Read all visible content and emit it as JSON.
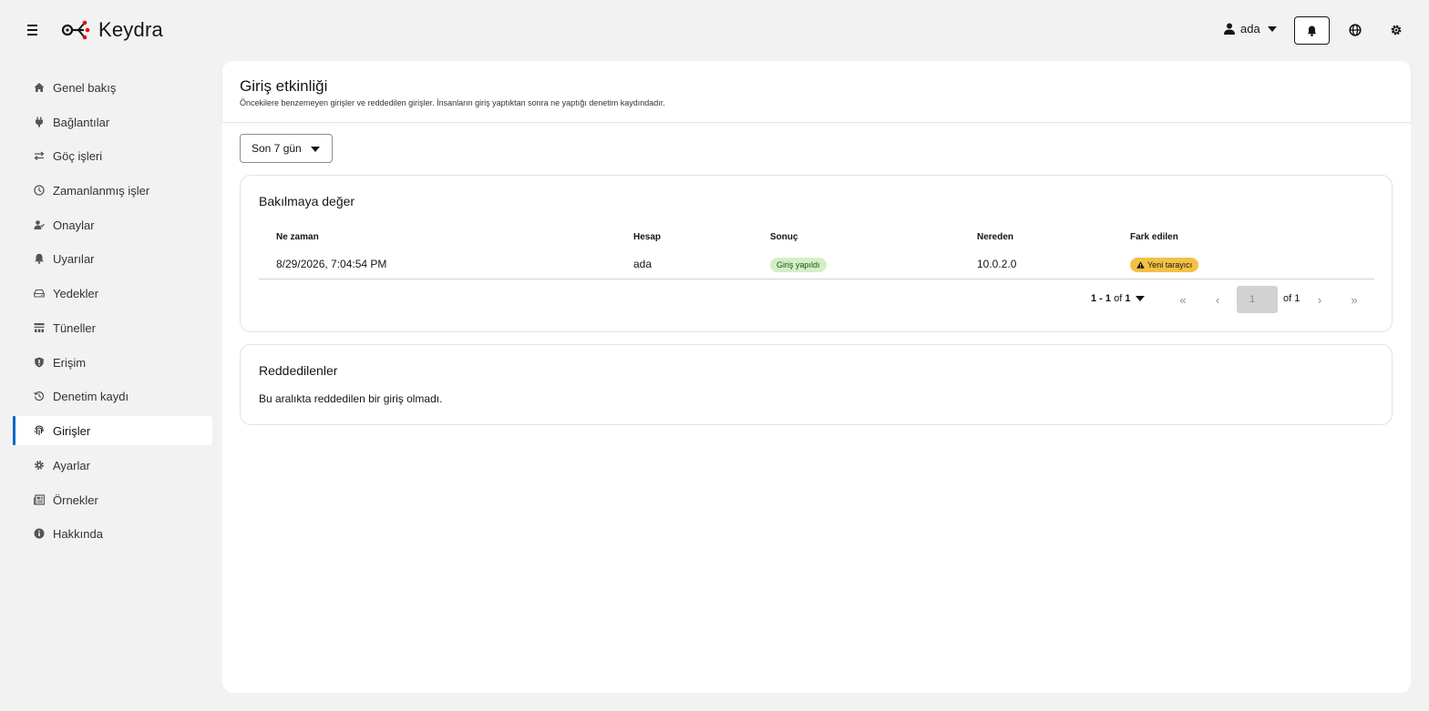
{
  "header": {
    "app_name": "Keydra",
    "user_name": "ada",
    "icons": [
      "hamburger-icon",
      "keydra-logo",
      "user-icon",
      "bell-icon",
      "globe-icon",
      "gear-icon"
    ]
  },
  "sidebar": {
    "items": [
      {
        "label": "Genel bakış",
        "icon": "home-icon"
      },
      {
        "label": "Bağlantılar",
        "icon": "plug-icon"
      },
      {
        "label": "Göç işleri",
        "icon": "exchange-icon"
      },
      {
        "label": "Zamanlanmış işler",
        "icon": "clock-icon"
      },
      {
        "label": "Onaylar",
        "icon": "user-check-icon"
      },
      {
        "label": "Uyarılar",
        "icon": "bell-icon"
      },
      {
        "label": "Yedekler",
        "icon": "drive-icon"
      },
      {
        "label": "Tüneller",
        "icon": "network-icon"
      },
      {
        "label": "Erişim",
        "icon": "shield-icon"
      },
      {
        "label": "Denetim kaydı",
        "icon": "history-icon"
      },
      {
        "label": "Girişler",
        "icon": "fingerprint-icon",
        "active": true
      },
      {
        "label": "Ayarlar",
        "icon": "gear-icon"
      },
      {
        "label": "Örnekler",
        "icon": "newspaper-icon"
      },
      {
        "label": "Hakkında",
        "icon": "info-icon"
      }
    ]
  },
  "page": {
    "title": "Giriş etkinliği",
    "subtitle": "Öncekilere benzemeyen girişler ve reddedilen girişler. İnsanların giriş yaptıktan sonra ne yaptığı denetim kaydındadır.",
    "range_select": "Son 7 gün"
  },
  "notable": {
    "title": "Bakılmaya değer",
    "columns": [
      "Ne zaman",
      "Hesap",
      "Sonuç",
      "Nereden",
      "Fark edilen"
    ],
    "rows": [
      {
        "when": "8/29/2026, 7:04:54 PM",
        "account": "ada",
        "result": "Giriş yapıldı",
        "from": "10.0.2.0",
        "noticed": "Yeni tarayıcı"
      }
    ],
    "pagination": {
      "range": "1 - 1",
      "of_word": "of",
      "total": "1",
      "page": "1",
      "of_pages": "of 1"
    }
  },
  "denied": {
    "title": "Reddedilenler",
    "empty": "Bu aralıkta reddedilen bir giriş olmadı."
  },
  "colors": {
    "accent": "#0066cc",
    "success_bg": "#d3f0c5",
    "warning_bg": "#f4c145",
    "logo_red": "#ee0000"
  }
}
